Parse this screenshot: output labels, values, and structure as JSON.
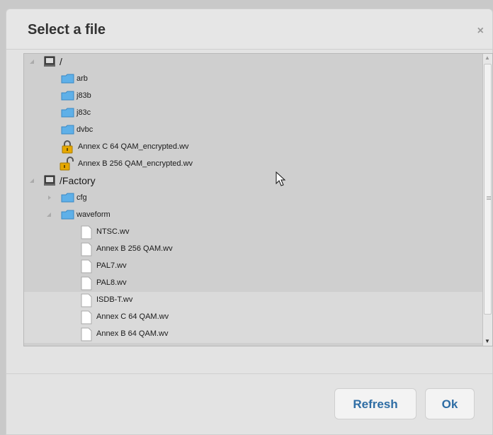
{
  "dialog": {
    "title": "Select a file",
    "close_glyph": "×"
  },
  "tree": {
    "items": [
      {
        "label": "/",
        "type": "drive",
        "icon": "hard-drive-icon",
        "expanded": true
      },
      {
        "label": "arb",
        "type": "folder",
        "icon": "folder-icon"
      },
      {
        "label": "j83b",
        "type": "folder",
        "icon": "folder-icon"
      },
      {
        "label": "j83c",
        "type": "folder",
        "icon": "folder-icon"
      },
      {
        "label": "dvbc",
        "type": "folder",
        "icon": "folder-icon"
      },
      {
        "label": "Annex C 64 QAM_encrypted.wv",
        "type": "file",
        "icon": "lock-closed-icon"
      },
      {
        "label": "Annex B 256 QAM_encrypted.wv",
        "type": "file",
        "icon": "lock-open-icon"
      },
      {
        "label": "/Factory",
        "type": "drive",
        "icon": "hard-drive-icon",
        "expanded": true
      },
      {
        "label": "cfg",
        "type": "folder",
        "icon": "folder-icon",
        "expanded": false
      },
      {
        "label": "waveform",
        "type": "folder",
        "icon": "folder-icon",
        "expanded": true
      },
      {
        "label": "NTSC.wv",
        "type": "file",
        "icon": "file-icon"
      },
      {
        "label": "Annex B 256 QAM.wv",
        "type": "file",
        "icon": "file-icon"
      },
      {
        "label": "PAL7.wv",
        "type": "file",
        "icon": "file-icon"
      },
      {
        "label": "PAL8.wv",
        "type": "file",
        "icon": "file-icon"
      },
      {
        "label": "ISDB-T.wv",
        "type": "file",
        "icon": "file-icon"
      },
      {
        "label": "Annex C 64 QAM.wv",
        "type": "file",
        "icon": "file-icon"
      },
      {
        "label": "Annex B 64 QAM.wv",
        "type": "file",
        "icon": "file-icon"
      }
    ]
  },
  "buttons": {
    "refresh_label": "Refresh",
    "ok_label": "Ok"
  },
  "colors": {
    "accent": "#2e6da4",
    "folder": "#5fb0e8",
    "lock": "#e6a800"
  }
}
